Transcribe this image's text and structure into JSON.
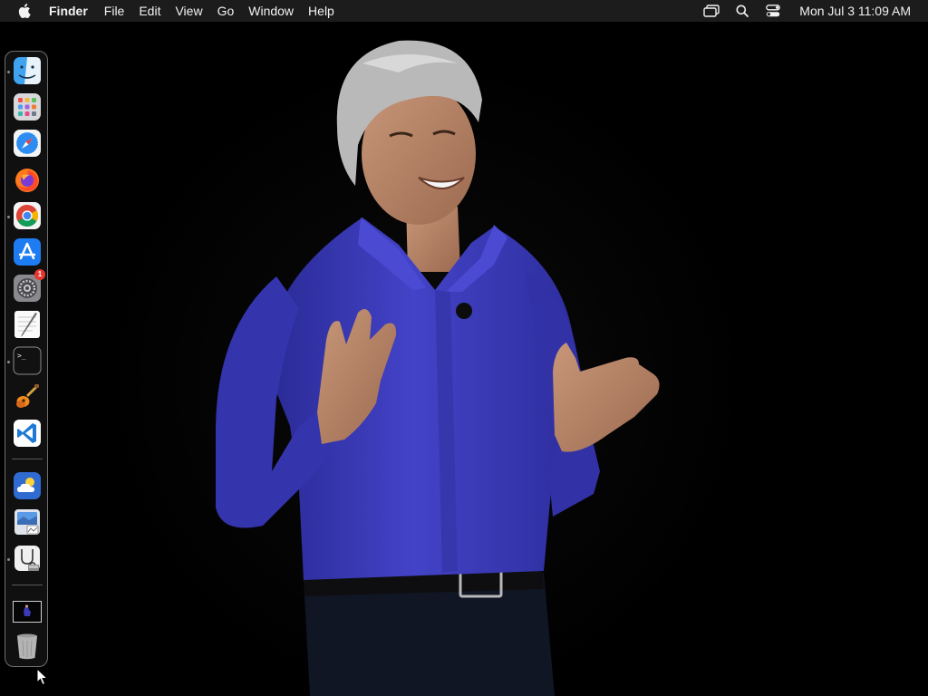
{
  "menubar": {
    "app_name": "Finder",
    "menus": [
      "File",
      "Edit",
      "View",
      "Go",
      "Window",
      "Help"
    ],
    "clock": "Mon Jul 3  11:09 AM",
    "status_icons": [
      "screen-mirroring-icon",
      "spotlight-search-icon",
      "control-center-icon"
    ]
  },
  "dock": {
    "items": [
      {
        "name": "Finder",
        "icon": "finder-icon",
        "running": true
      },
      {
        "name": "Launchpad",
        "icon": "launchpad-icon",
        "running": false
      },
      {
        "name": "Safari",
        "icon": "safari-icon",
        "running": false
      },
      {
        "name": "Firefox",
        "icon": "firefox-icon",
        "running": false
      },
      {
        "name": "Google Chrome",
        "icon": "chrome-icon",
        "running": true
      },
      {
        "name": "App Store",
        "icon": "app-store-icon",
        "running": false
      },
      {
        "name": "System Settings",
        "icon": "system-settings-icon",
        "running": false,
        "badge": "1"
      },
      {
        "name": "TextEdit",
        "icon": "textedit-icon",
        "running": false
      },
      {
        "name": "Terminal",
        "icon": "terminal-icon",
        "running": true
      },
      {
        "name": "GarageBand",
        "icon": "garageband-icon",
        "running": false
      },
      {
        "name": "Visual Studio Code",
        "icon": "vscode-icon",
        "running": false
      },
      {
        "name": "Weather",
        "icon": "weather-icon",
        "running": false
      },
      {
        "name": "Preview",
        "icon": "preview-icon",
        "running": false
      },
      {
        "name": "Disk Utility",
        "icon": "disk-utility-icon",
        "running": true
      },
      {
        "name": "Desktop Image",
        "icon": "image-thumbnail-icon",
        "running": false
      },
      {
        "name": "Trash",
        "icon": "trash-icon",
        "running": false
      }
    ],
    "terminal_prompt": ">_"
  },
  "colors": {
    "menubar_bg": "#1c1c1c",
    "desktop_bg": "#000000",
    "shirt": "#3b3bb8",
    "badge": "#e8372f"
  }
}
